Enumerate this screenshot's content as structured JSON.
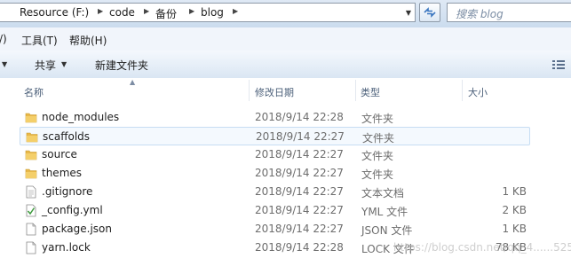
{
  "address": {
    "crumbs": [
      "Resource (F:)",
      "code",
      "备份",
      "blog"
    ]
  },
  "search": {
    "placeholder": "搜索 blog"
  },
  "menu": {
    "items": [
      "/)",
      "工具(T)",
      "帮助(H)"
    ]
  },
  "toolbar": {
    "share_label": "共享",
    "new_folder_label": "新建文件夹"
  },
  "columns": {
    "name": "名称",
    "date": "修改日期",
    "type": "类型",
    "size": "大小"
  },
  "files": [
    {
      "name": "node_modules",
      "date": "2018/9/14 22:28",
      "type": "文件夹",
      "size": "",
      "icon": "folder-icon"
    },
    {
      "name": "scaffolds",
      "date": "2018/9/14 22:27",
      "type": "文件夹",
      "size": "",
      "icon": "folder-icon",
      "selected": true
    },
    {
      "name": "source",
      "date": "2018/9/14 22:27",
      "type": "文件夹",
      "size": "",
      "icon": "folder-icon"
    },
    {
      "name": "themes",
      "date": "2018/9/14 22:27",
      "type": "文件夹",
      "size": "",
      "icon": "folder-icon"
    },
    {
      "name": ".gitignore",
      "date": "2018/9/14 22:27",
      "type": "文本文档",
      "size": "1 KB",
      "icon": "text-file-icon"
    },
    {
      "name": "_config.yml",
      "date": "2018/9/14 22:27",
      "type": "YML 文件",
      "size": "2 KB",
      "icon": "yml-file-icon"
    },
    {
      "name": "package.json",
      "date": "2018/9/14 22:27",
      "type": "JSON 文件",
      "size": "1 KB",
      "icon": "file-icon"
    },
    {
      "name": "yarn.lock",
      "date": "2018/9/14 22:28",
      "type": "LOCK 文件",
      "size": "78 KB",
      "icon": "file-icon"
    }
  ],
  "watermark": "https://blog.csdn.net/qq_4......525",
  "colors": {
    "folder": "#e8b84a",
    "selection": "#c7ddf3",
    "header_text": "#4c607a"
  }
}
